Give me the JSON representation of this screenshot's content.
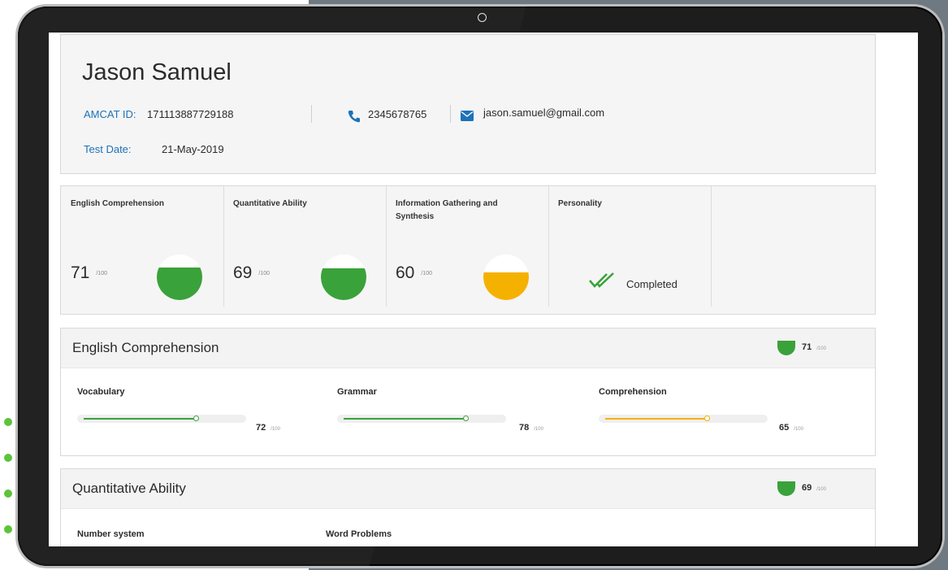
{
  "profile": {
    "name": "Jason Samuel",
    "amcat_label": "AMCAT ID:",
    "amcat_id": "171113887729188",
    "phone": "2345678765",
    "email": "jason.samuel@gmail.com",
    "test_date_label": "Test Date:",
    "test_date": "21-May-2019"
  },
  "scores": [
    {
      "title": "English Comprehension",
      "value": "71",
      "scale": "/100",
      "fill": 0.71,
      "color": "#3aa23a"
    },
    {
      "title": "Quantitative Ability",
      "value": "69",
      "scale": "/100",
      "fill": 0.69,
      "color": "#3aa23a"
    },
    {
      "title": "Information Gathering and Synthesis",
      "value": "60",
      "scale": "/100",
      "fill": 0.6,
      "color": "#f5b100"
    }
  ],
  "personality": {
    "title": "Personality",
    "status": "Completed"
  },
  "english_section": {
    "title": "English Comprehension",
    "score": "71",
    "scale": "/100",
    "subscores": [
      {
        "label": "Vocabulary",
        "value": "72",
        "scale": "/100",
        "fill": 0.72,
        "color": "#3aa23a"
      },
      {
        "label": "Grammar",
        "value": "78",
        "scale": "/100",
        "fill": 0.78,
        "color": "#3aa23a"
      },
      {
        "label": "Comprehension",
        "value": "65",
        "scale": "/100",
        "fill": 0.65,
        "color": "#f5b100"
      }
    ]
  },
  "quant_section": {
    "title": "Quantitative Ability",
    "score": "69",
    "scale": "/100",
    "subscores": [
      {
        "label": "Number system"
      },
      {
        "label": "Word Problems"
      }
    ]
  },
  "colors": {
    "accent_blue": "#1d72b8",
    "green": "#3aa23a",
    "yellow": "#f5b100"
  },
  "icons": [
    "phone-icon",
    "mail-icon",
    "double-check-icon",
    "tablet-camera-icon"
  ]
}
